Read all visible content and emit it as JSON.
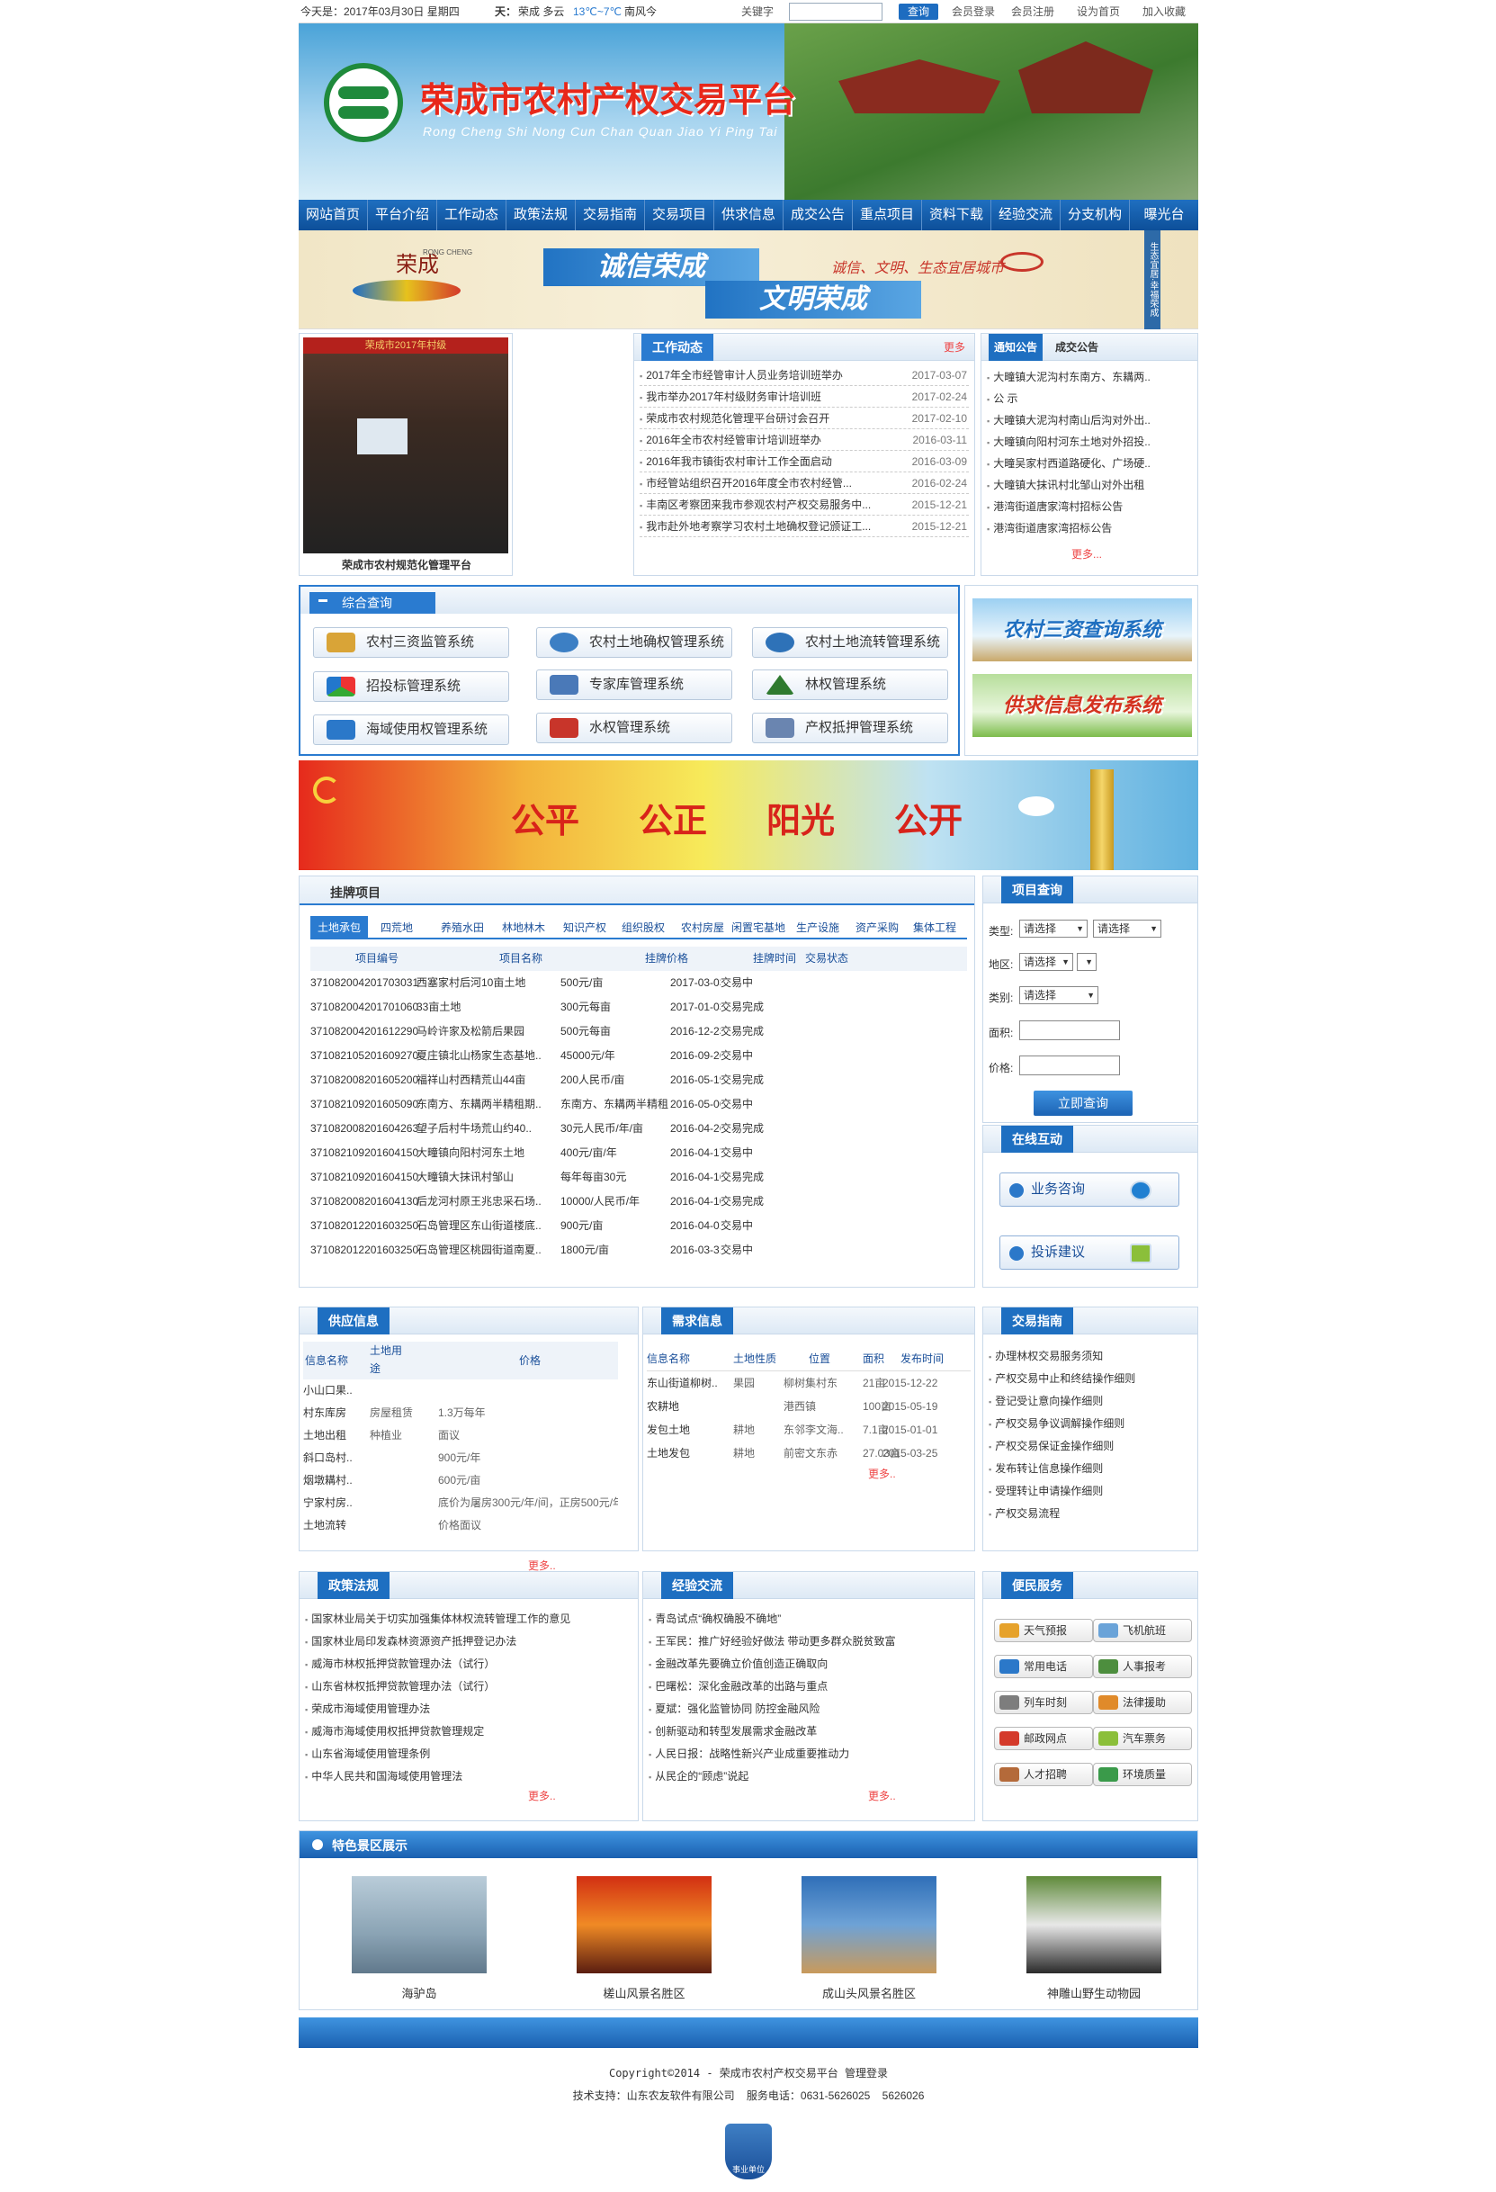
{
  "topbar": {
    "date": "今天是：2017年03月30日 星期四",
    "weather_label": "天：",
    "weather": "荣成 多云",
    "temp": "13℃~7℃",
    "wind": "南风今",
    "keyword_label": "关键字",
    "search_btn": "查询",
    "links": [
      "会员登录",
      "会员注册",
      "设为首页",
      "加入收藏"
    ]
  },
  "header": {
    "title": "荣成市农村产权交易平台",
    "subtitle": "Rong Cheng Shi Nong Cun Chan Quan Jiao Yi Ping Tai"
  },
  "nav": [
    "网站首页",
    "平台介绍",
    "工作动态",
    "政策法规",
    "交易指南",
    "交易项目",
    "供求信息",
    "成交公告",
    "重点项目",
    "资料下载",
    "经验交流",
    "分支机构",
    "曝光台"
  ],
  "banner1": {
    "logo_text": "荣成",
    "logo_sub": "RONG CHENG",
    "line1": "诚信荣成",
    "line2": "文明荣成",
    "slogan": "诚信、文明、生态宜居城市",
    "vert": "生态宜居·幸福荣成"
  },
  "photo_caption": "荣成市农村规范化管理平台",
  "photo_banner": "荣成市2017年村级",
  "work": {
    "title": "工作动态",
    "more": "更多",
    "items": [
      {
        "t": "2017年全市经管审计人员业务培训班举办",
        "d": "2017-03-07"
      },
      {
        "t": "我市举办2017年村级财务审计培训班",
        "d": "2017-02-24"
      },
      {
        "t": "荣成市农村规范化管理平台研讨会召开",
        "d": "2017-02-10"
      },
      {
        "t": "2016年全市农村经管审计培训班举办",
        "d": "2016-03-11"
      },
      {
        "t": "2016年我市镇街农村审计工作全面启动",
        "d": "2016-03-09"
      },
      {
        "t": "市经管站组织召开2016年度全市农村经管...",
        "d": "2016-02-24"
      },
      {
        "t": "丰南区考察团来我市参观农村产权交易服务中...",
        "d": "2015-12-21"
      },
      {
        "t": "我市赴外地考察学习农村土地确权登记颁证工...",
        "d": "2015-12-21"
      }
    ]
  },
  "notice": {
    "tab1": "通知公告",
    "tab2": "成交公告",
    "more": "更多...",
    "items": [
      "大疃镇大泥沟村东南方、东耩两..",
      "公 示",
      "大疃镇大泥沟村南山后沟对外出..",
      "大疃镇向阳村河东土地对外招投..",
      "大疃吴家村西道路硬化、广场硬..",
      "大疃镇大抹讯村北邹山对外出租",
      "港湾街道唐家湾村招标公告",
      "港湾街道唐家湾招标公告"
    ]
  },
  "query": {
    "title": "综合查询",
    "buttons": [
      "农村三资监管系统",
      "农村土地确权管理系统",
      "农村土地流转管理系统",
      "招投标管理系统",
      "专家库管理系统",
      "林权管理系统",
      "海域使用权管理系统",
      "水权管理系统",
      "产权抵押管理系统"
    ]
  },
  "sys_banners": [
    "农村三资查询系统",
    "供求信息发布系统"
  ],
  "banner2": {
    "words": [
      "公平",
      "公正",
      "阳光",
      "公开"
    ]
  },
  "projects": {
    "title": "挂牌项目",
    "tabs": [
      "土地承包",
      "四荒地",
      "养殖水田",
      "林地林木",
      "知识产权",
      "组织股权",
      "农村房屋",
      "闲置宅基地",
      "生产设施",
      "资产采购",
      "集体工程"
    ],
    "headers": [
      "项目编号",
      "项目名称",
      "挂牌价格",
      "挂牌时间",
      "交易状态"
    ],
    "rows": [
      [
        "371082004201703031046146",
        "西塞家村后河10亩土地",
        "500元/亩",
        "2017-03-03",
        "交易中"
      ],
      [
        "371082004201701060301263",
        "33亩土地",
        "300元每亩",
        "2017-01-03",
        "交易完成"
      ],
      [
        "371082004201612290352360",
        "马岭许家及松箭后果园",
        "500元每亩",
        "2016-12-23",
        "交易完成"
      ],
      [
        "371082105201609270816586",
        "夏庄镇北山杨家生态基地..",
        "45000元/年",
        "2016-09-26",
        "交易中"
      ],
      [
        "371082008201605200825151",
        "福祥山村西精荒山44亩",
        "200人民币/亩",
        "2016-05-19",
        "交易完成"
      ],
      [
        "371082109201605090808281",
        "东南方、东耩两半精租期..",
        "东南方、东耩两半精租期..",
        "2016-05-06",
        "交易中"
      ],
      [
        "371082008201604263580080",
        "望子后村牛场荒山约40..",
        "30元人民币/年/亩",
        "2016-04-26",
        "交易完成"
      ],
      [
        "371082109201604150239314",
        "大疃镇向阳村河东土地",
        "400元/亩/年",
        "2016-04-17",
        "交易中"
      ],
      [
        "371082109201604150219354",
        "大疃镇大抹讯村邹山",
        "每年每亩30元",
        "2016-04-16",
        "交易完成"
      ],
      [
        "371082008201604130800550",
        "后龙河村原王兆忠采石场..",
        "10000/人民币/年",
        "2016-04-10",
        "交易完成"
      ],
      [
        "371082012201603250356365",
        "石岛管理区东山街道楼底..",
        "900元/亩",
        "2016-04-01",
        "交易中"
      ],
      [
        "371082012201603250355015",
        "石岛管理区桃园街道南夏..",
        "1800元/亩",
        "2016-03-31",
        "交易中"
      ]
    ]
  },
  "pq": {
    "title": "项目查询",
    "type_label": "类型:",
    "region_label": "地区:",
    "cat_label": "类别:",
    "area_label": "面积:",
    "price_label": "价格:",
    "select": "请选择",
    "btn": "立即查询"
  },
  "online": {
    "title": "在线互动",
    "btn1": "业务咨询",
    "btn2": "投诉建议"
  },
  "supply": {
    "title": "供应信息",
    "headers": [
      "信息名称",
      "土地用途",
      "价格"
    ],
    "more": "更多..",
    "rows": [
      [
        "小山口果..",
        "",
        ""
      ],
      [
        "村东库房",
        "房屋租赁",
        "1.3万每年"
      ],
      [
        "土地出租",
        "种植业",
        "面议"
      ],
      [
        "斜口岛村..",
        "",
        "900元/年"
      ],
      [
        "烟墩耩村..",
        "",
        "600元/亩"
      ],
      [
        "宁家村房..",
        "",
        "底价为屠房300元/年/间，正房500元/年"
      ],
      [
        "土地流转",
        "",
        "价格面议"
      ]
    ]
  },
  "demand": {
    "title": "需求信息",
    "headers": [
      "信息名称",
      "土地性质",
      "位置",
      "面积",
      "发布时间"
    ],
    "more": "更多..",
    "rows": [
      [
        "东山街道柳树..",
        "果园",
        "柳树集村东",
        "21亩",
        "2015-12-22"
      ],
      [
        "农耕地",
        "",
        "港西镇",
        "100亩",
        "2015-05-19"
      ],
      [
        "发包土地",
        "耕地",
        "东邻李文海..",
        "7.1亩",
        "2015-01-01"
      ],
      [
        "土地发包",
        "耕地",
        "前密文东赤",
        "27.03亩",
        "2015-03-25"
      ]
    ]
  },
  "guide": {
    "title": "交易指南",
    "items": [
      "办理林权交易服务须知",
      "产权交易中止和终结操作细则",
      "登记受让意向操作细则",
      "产权交易争议调解操作细则",
      "产权交易保证金操作细则",
      "发布转让信息操作细则",
      "受理转让申请操作细则",
      "产权交易流程"
    ]
  },
  "policy": {
    "title": "政策法规",
    "more": "更多..",
    "items": [
      "国家林业局关于切实加强集体林权流转管理工作的意见",
      "国家林业局印发森林资源资产抵押登记办法",
      "威海市林权抵押贷款管理办法（试行）",
      "山东省林权抵押贷款管理办法（试行）",
      "荣成市海域使用管理办法",
      "威海市海域使用权抵押贷款管理规定",
      "山东省海域使用管理条例",
      "中华人民共和国海域使用管理法"
    ]
  },
  "exp": {
    "title": "经验交流",
    "more": "更多..",
    "items": [
      "青岛试点“确权确股不确地”",
      "王军民：推广好经验好做法 带动更多群众脱贫致富",
      "金融改革先要确立价值创造正确取向",
      "巴曙松：深化金融改革的出路与重点",
      "夏斌：强化监管协同 防控金融风险",
      "创新驱动和转型发展需求金融改革",
      "人民日报：战略性新兴产业成重要推动力",
      "从民企的“顾虑”说起"
    ]
  },
  "service": {
    "title": "便民服务",
    "items": [
      "天气预报",
      "飞机航班",
      "常用电话",
      "人事报考",
      "列车时刻",
      "法律援助",
      "邮政网点",
      "汽车票务",
      "人才招聘",
      "环境质量"
    ]
  },
  "scenic": {
    "title": "特色景区展示",
    "items": [
      "海驴岛",
      "槎山风景名胜区",
      "成山头风景名胜区",
      "神雕山野生动物园"
    ]
  },
  "footer": {
    "line1": "Copyright©2014 - 荣成市农村产权交易平台 管理登录",
    "line2": "技术支持：山东农友软件有限公司    服务电话：0631-5626025    5626026",
    "badge": "事业单位"
  }
}
